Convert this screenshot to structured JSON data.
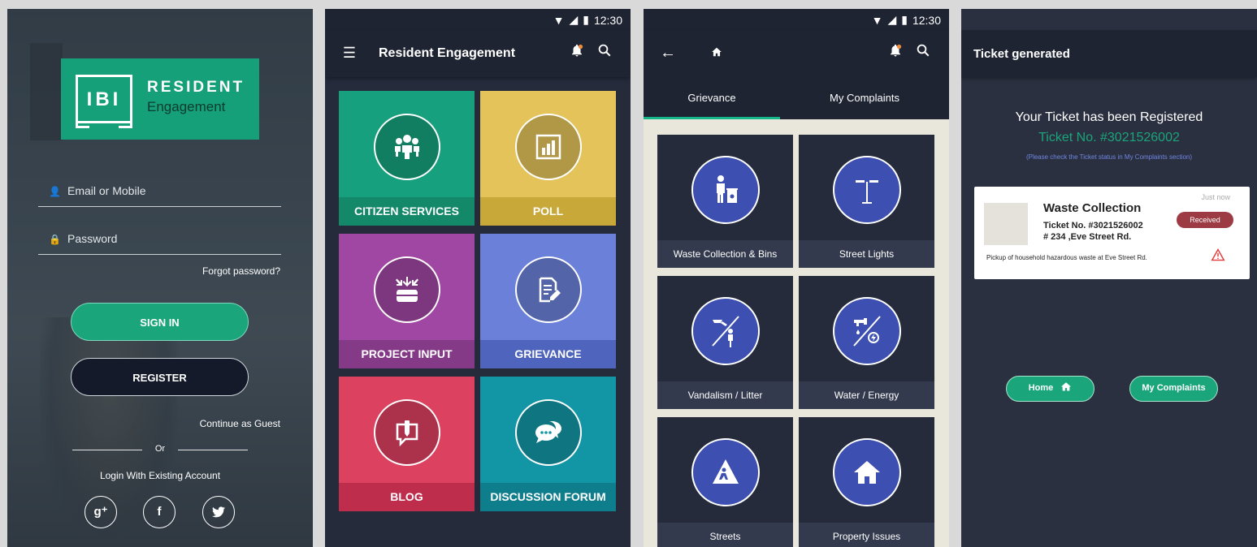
{
  "screen1": {
    "logo": {
      "mark": "IBI",
      "line1": "RESIDENT",
      "line2": "Engagement"
    },
    "email_label": "Email or Mobile",
    "password_label": "Password",
    "forgot": "Forgot password?",
    "signin": "SIGN IN",
    "register": "REGISTER",
    "guest": "Continue as Guest",
    "or": "Or",
    "login_existing": "Login With Existing Account",
    "social": [
      {
        "name": "google-plus-icon",
        "glyph": "g⁺"
      },
      {
        "name": "facebook-icon",
        "glyph": "f"
      },
      {
        "name": "twitter-icon",
        "glyph": "🐦"
      }
    ]
  },
  "status": {
    "time": "12:30"
  },
  "screen2": {
    "title": "Resident Engagement",
    "tiles": [
      {
        "label": "CITIZEN SERVICES",
        "color": "#17a07d",
        "foot": "#13896a"
      },
      {
        "label": "POLL",
        "color": "#e3c35a",
        "foot": "#c9a83a"
      },
      {
        "label": "PROJECT INPUT",
        "color": "#a047a3",
        "foot": "#843a87"
      },
      {
        "label": "GRIEVANCE",
        "color": "#6b80d8",
        "foot": "#4e64bd"
      },
      {
        "label": "BLOG",
        "color": "#dd4160",
        "foot": "#bf2d4c"
      },
      {
        "label": "DISCUSSION FORUM",
        "color": "#1296a6",
        "foot": "#0f7e8c"
      }
    ]
  },
  "screen3": {
    "tabs": [
      "Grievance",
      "My Complaints"
    ],
    "tiles": [
      {
        "label": "Waste Collection & Bins"
      },
      {
        "label": "Street Lights"
      },
      {
        "label": "Vandalism / Litter"
      },
      {
        "label": "Water / Energy"
      },
      {
        "label": "Streets"
      },
      {
        "label": "Property Issues"
      }
    ]
  },
  "screen4": {
    "title": "Ticket generated",
    "heading": "Your Ticket has been Registered",
    "ticket": "Ticket No. #3021526002",
    "note": "(Please check the Ticket status in My Complaints section)",
    "card": {
      "title": "Waste Collection",
      "ticket": "Ticket No. #3021526002",
      "address": "# 234 ,Eve Street Rd.",
      "time": "Just now",
      "status": "Received",
      "desc": "Pickup of household hazardous waste at Eve Street Rd."
    },
    "home": "Home",
    "complaints": "My Complaints"
  }
}
